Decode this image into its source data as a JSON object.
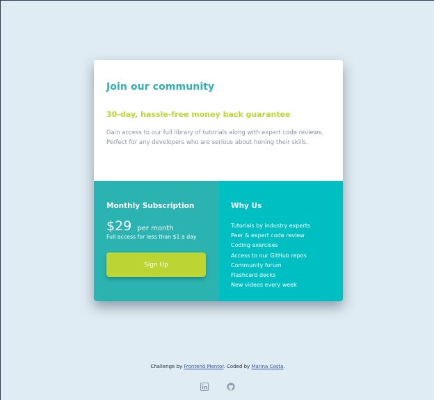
{
  "card": {
    "title": "Join our community",
    "guarantee": "30-day, hassle-free money back guarantee",
    "description": "Gain access to our full library of tutorials along with expert code reviews. Perfect for any developers who are serious about honing their skills."
  },
  "subscription": {
    "title": "Monthly Subscription",
    "price": "$29",
    "period": "per month",
    "note": "Full access for less than $1 a day",
    "button_label": "Sign Up"
  },
  "why": {
    "title": "Why Us",
    "items": [
      "Tutorials by industry experts",
      "Peer & expert code review",
      "Coding exercises",
      "Access to our GitHub repos",
      "Community forum",
      "Flashcard decks",
      "New videos every week"
    ]
  },
  "footer": {
    "prefix": "Challenge by ",
    "link1": "Frontend Mentor",
    "middle": ". Coded by ",
    "link2": "Marina Costa",
    "suffix": ".",
    "icons": [
      "linkedin-icon",
      "github-icon"
    ]
  },
  "colors": {
    "background": "#e0ecf3",
    "teal": "#2bb3b1",
    "cyan": "#00bfc2",
    "lime": "#bcd532",
    "gray_text": "#8b94a8"
  }
}
